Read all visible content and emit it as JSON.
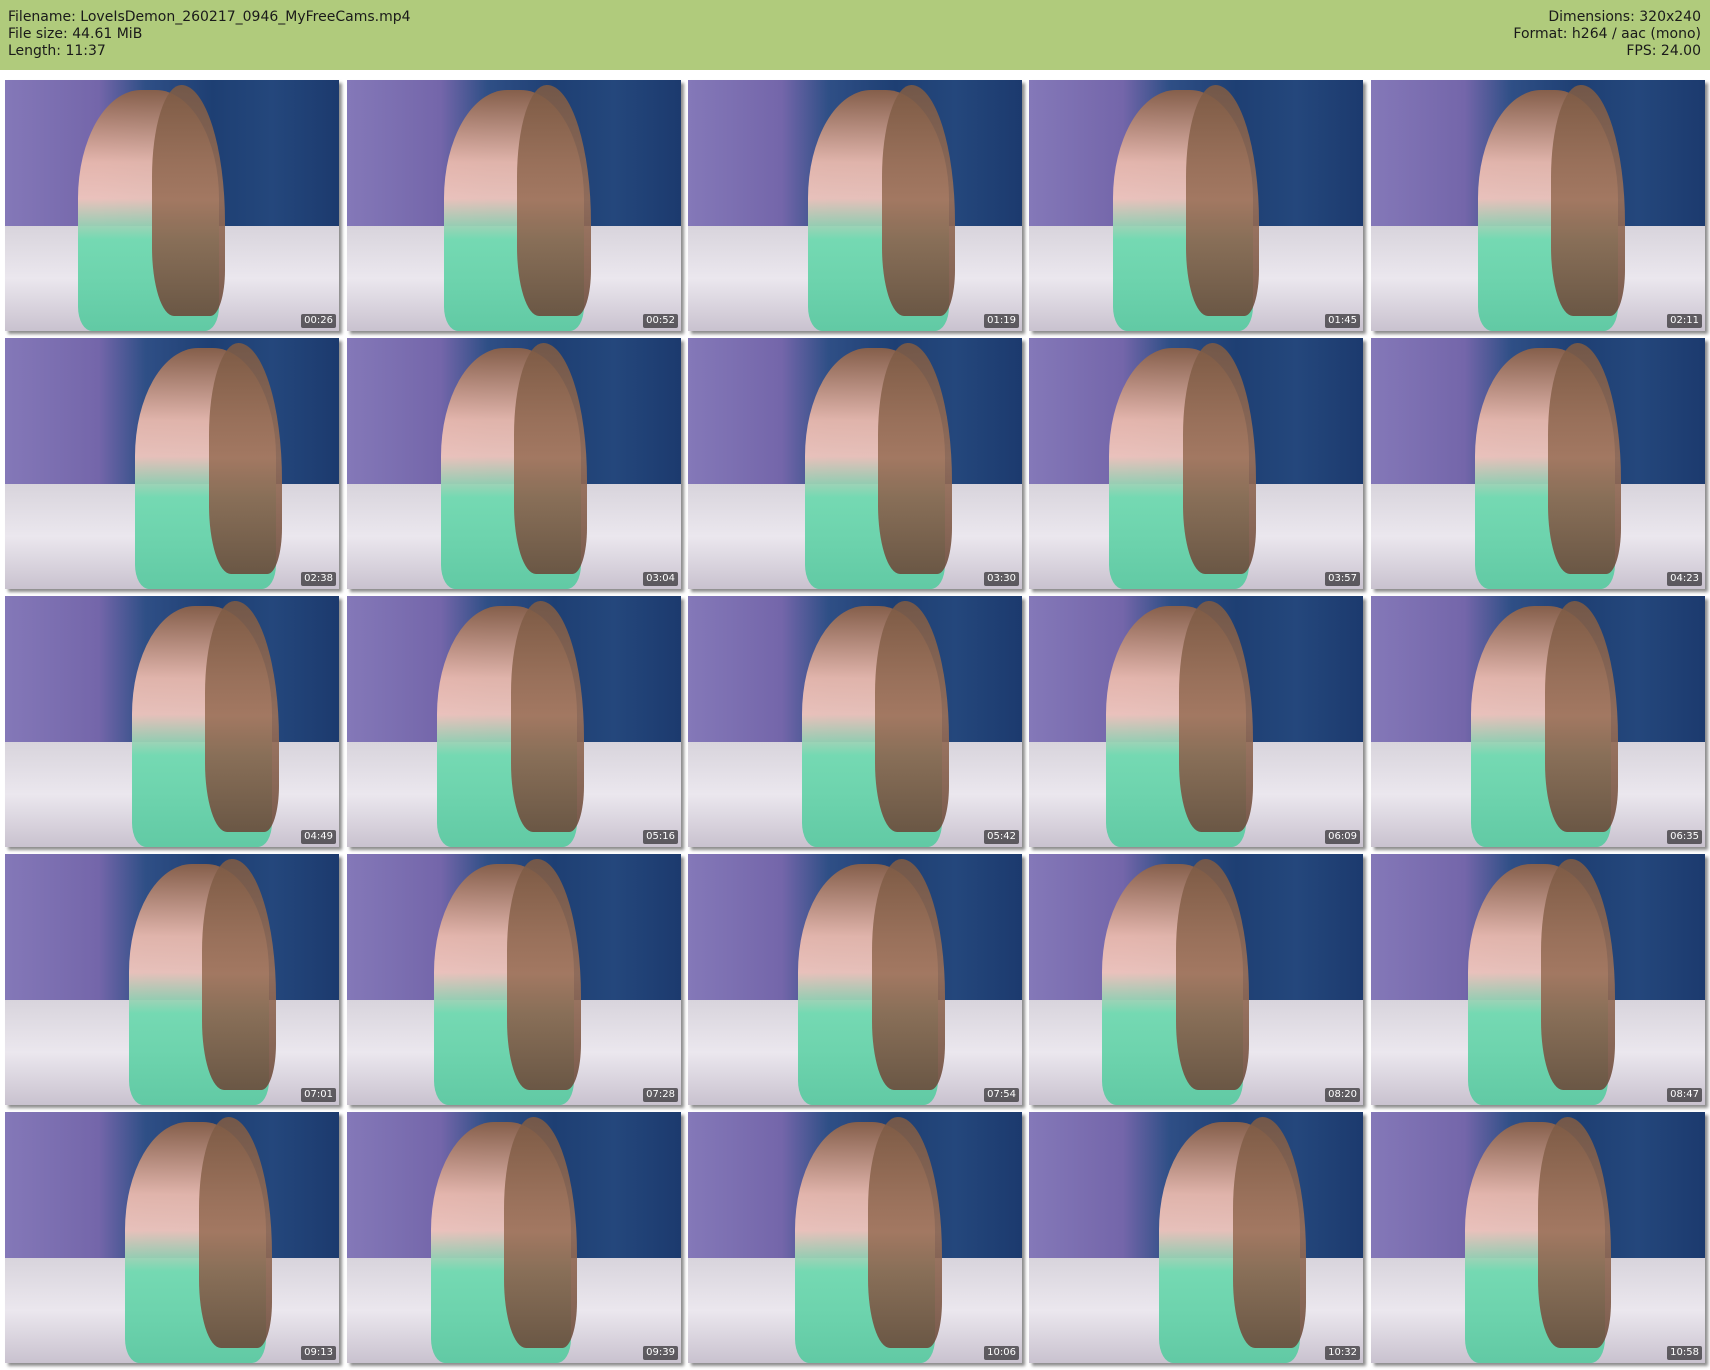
{
  "header": {
    "filename": "Filename: LoveIsDemon_260217_0946_MyFreeCams.mp4",
    "filesize": "File size: 44.61 MiB",
    "length": "Length: 11:37",
    "dimensions": "Dimensions: 320x240",
    "format": "Format: h264 / aac (mono)",
    "fps": "FPS: 24.00"
  },
  "timestamps": [
    "00:26",
    "00:52",
    "01:19",
    "01:45",
    "02:11",
    "02:38",
    "03:04",
    "03:30",
    "03:57",
    "04:23",
    "04:49",
    "05:16",
    "05:42",
    "06:09",
    "06:35",
    "07:01",
    "07:28",
    "07:54",
    "08:20",
    "08:47",
    "09:13",
    "09:39",
    "10:06",
    "10:32",
    "10:58"
  ],
  "colors": {
    "header_bg": "#b0cb7c"
  }
}
